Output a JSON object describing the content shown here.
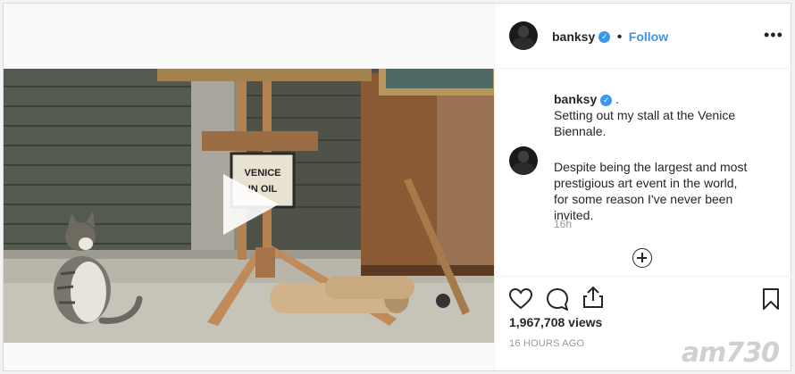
{
  "post": {
    "username": "banksy",
    "follow_label": "Follow",
    "caption_author": "banksy",
    "caption_suffix": ".",
    "caption_line1": "Setting out my stall at the Venice Biennale.",
    "comment_text": "Despite being the largest and most prestigious art event in the world, for some reason I've never been invited.",
    "comment_time": "16h",
    "views": "1,967,708 views",
    "posted_ago": "16 HOURS AGO",
    "sign_text": "VENICE IN OIL"
  },
  "watermark": "am730",
  "icons": {
    "verified": "verified-badge-icon",
    "more": "more-options-icon",
    "like": "heart-icon",
    "comment": "comment-icon",
    "share": "share-icon",
    "save": "bookmark-icon",
    "play": "play-icon",
    "load_more": "plus-circle-icon"
  },
  "colors": {
    "accent": "#3897f0",
    "text": "#262626",
    "muted": "#999999"
  }
}
